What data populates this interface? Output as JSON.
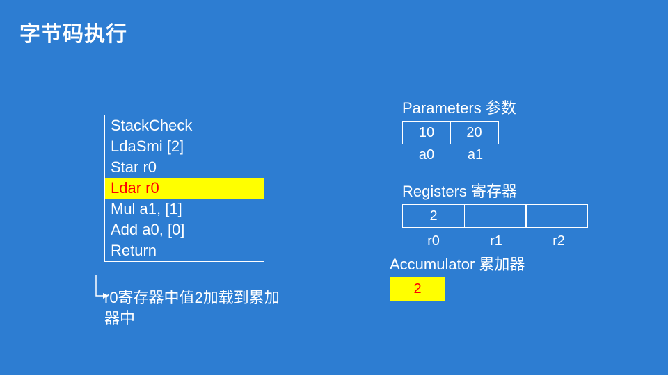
{
  "title": "字节码执行",
  "bytecode": {
    "instructions": [
      {
        "text": "StackCheck",
        "highlight": false
      },
      {
        "text": "LdaSmi [2]",
        "highlight": false
      },
      {
        "text": "Star r0",
        "highlight": false
      },
      {
        "text": "Ldar r0",
        "highlight": true
      },
      {
        "text": "Mul a1, [1]",
        "highlight": false
      },
      {
        "text": "Add a0, [0]",
        "highlight": false
      },
      {
        "text": "Return",
        "highlight": false
      }
    ]
  },
  "annotation": "r0寄存器中值2加载到累加器中",
  "parameters": {
    "label": "Parameters 参数",
    "cells": [
      {
        "value": "10",
        "name": "a0"
      },
      {
        "value": "20",
        "name": "a1"
      }
    ]
  },
  "registers": {
    "label": "Registers 寄存器",
    "cells": [
      {
        "value": "2",
        "name": "r0"
      },
      {
        "value": "",
        "name": "r1"
      },
      {
        "value": "",
        "name": "r2"
      }
    ]
  },
  "accumulator": {
    "label": "Accumulator 累加器",
    "value": "2"
  }
}
